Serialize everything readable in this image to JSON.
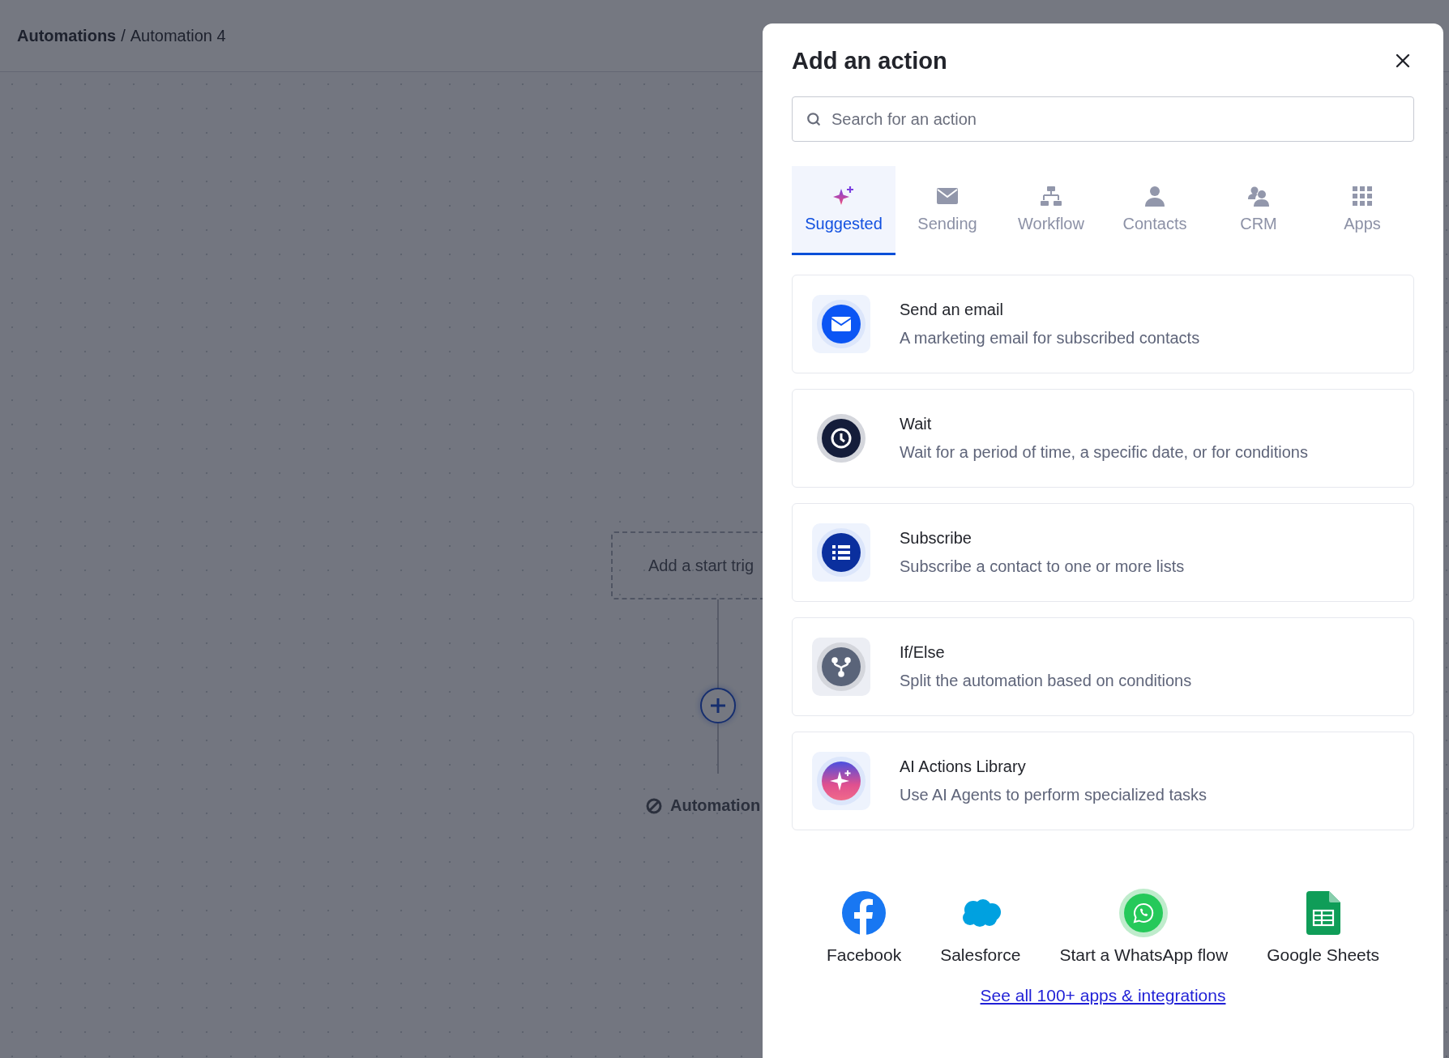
{
  "breadcrumb": {
    "parent": "Automations",
    "separator": "/",
    "current": "Automation 4"
  },
  "canvas": {
    "trigger_node": "Add a start trig",
    "status": "Automation"
  },
  "dialog": {
    "title": "Add an action",
    "search": {
      "placeholder": "Search for an action"
    },
    "tabs": [
      {
        "kind": "suggested",
        "label": "Suggested",
        "selected": true
      },
      {
        "kind": "sending",
        "label": "Sending",
        "selected": false
      },
      {
        "kind": "workflow",
        "label": "Workflow",
        "selected": false
      },
      {
        "kind": "contacts",
        "label": "Contacts",
        "selected": false
      },
      {
        "kind": "crm",
        "label": "CRM",
        "selected": false
      },
      {
        "kind": "apps",
        "label": "Apps",
        "selected": false
      }
    ],
    "actions": [
      {
        "kind": "email",
        "title": "Send an email",
        "description": "A marketing email for subscribed contacts"
      },
      {
        "kind": "wait",
        "title": "Wait",
        "description": "Wait for a period of time, a specific date, or for conditions"
      },
      {
        "kind": "subscribe",
        "title": "Subscribe",
        "description": "Subscribe a contact to one or more lists"
      },
      {
        "kind": "ifelse",
        "title": "If/Else",
        "description": "Split the automation based on conditions"
      },
      {
        "kind": "ai",
        "title": "AI Actions Library",
        "description": "Use AI Agents to perform specialized tasks"
      }
    ],
    "apps": [
      {
        "kind": "facebook",
        "label": "Facebook"
      },
      {
        "kind": "salesforce",
        "label": "Salesforce"
      },
      {
        "kind": "whatsapp",
        "label": "Start a WhatsApp flow"
      },
      {
        "kind": "sheets",
        "label": "Google Sheets"
      }
    ],
    "link": "See all 100+ apps & integrations"
  }
}
